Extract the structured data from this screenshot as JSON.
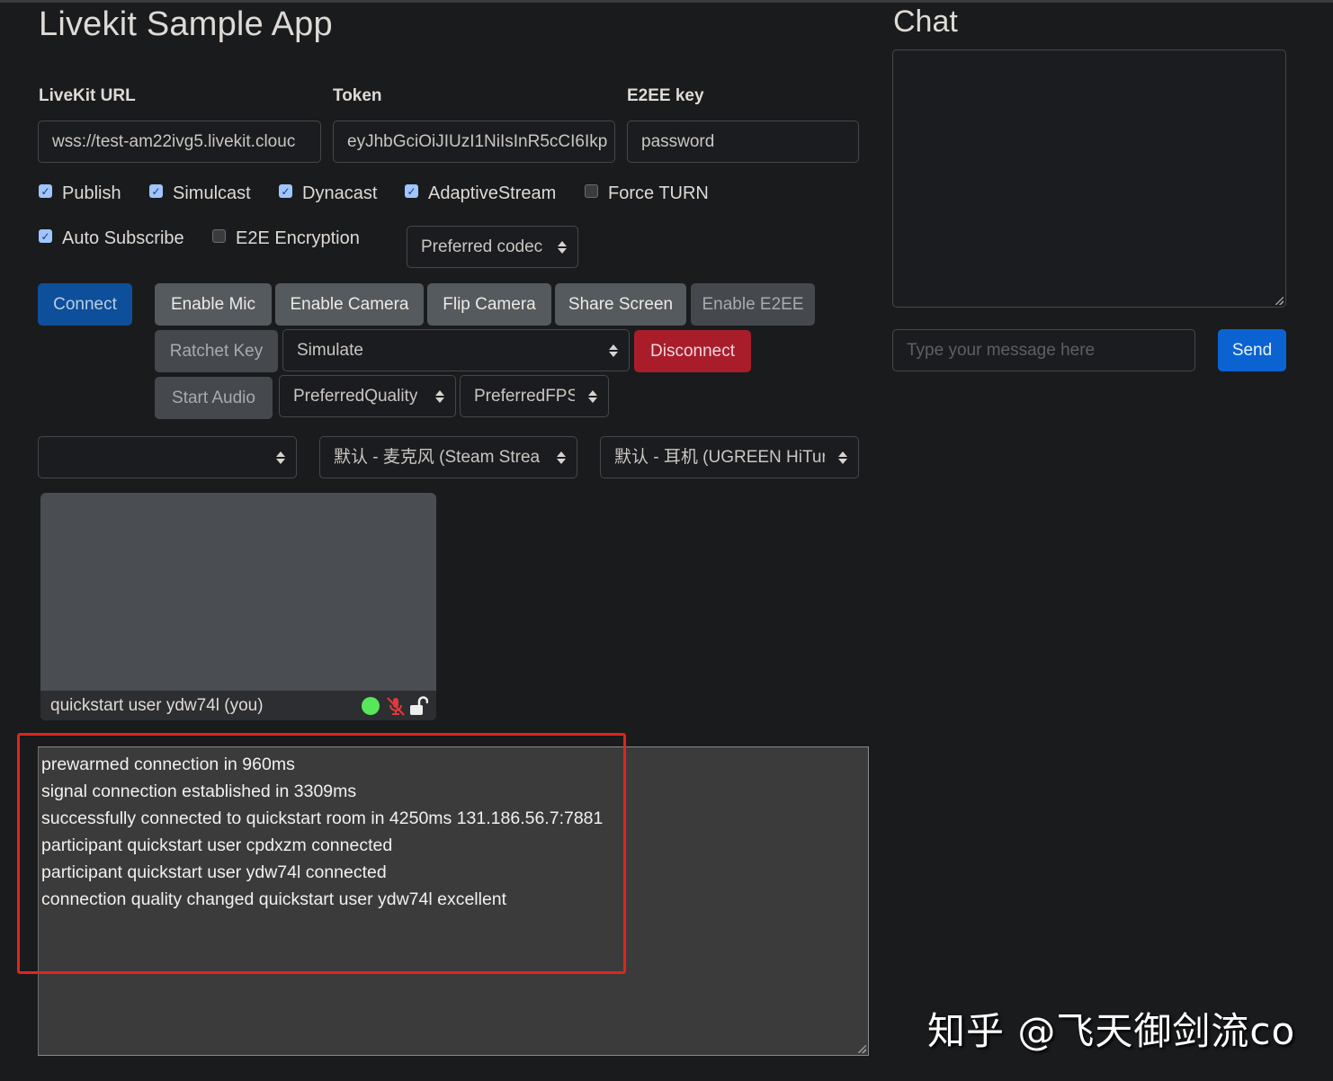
{
  "app": {
    "title": "Livekit Sample App"
  },
  "form": {
    "url_label": "LiveKit URL",
    "url_value": "wss://test-am22ivg5.livekit.clouc",
    "token_label": "Token",
    "token_value": "eyJhbGciOiJIUzI1NiIsInR5cCI6Ikp",
    "e2ee_label": "E2EE key",
    "e2ee_value": "password"
  },
  "options": [
    {
      "label": "Publish",
      "checked": true
    },
    {
      "label": "Simulcast",
      "checked": true
    },
    {
      "label": "Dynacast",
      "checked": true
    },
    {
      "label": "AdaptiveStream",
      "checked": true
    },
    {
      "label": "Force TURN",
      "checked": false
    },
    {
      "label": "Auto Subscribe",
      "checked": true
    },
    {
      "label": "E2E Encryption",
      "checked": false
    }
  ],
  "codec_select": {
    "value": "Preferred codec"
  },
  "buttons": {
    "connect": "Connect",
    "enable_mic": "Enable Mic",
    "enable_camera": "Enable Camera",
    "flip_camera": "Flip Camera",
    "share_screen": "Share Screen",
    "enable_e2ee": "Enable E2EE",
    "ratchet_key": "Ratchet Key",
    "disconnect": "Disconnect",
    "start_audio": "Start Audio"
  },
  "simulate_select": {
    "value": "Simulate"
  },
  "quality_select": {
    "value": "PreferredQuality"
  },
  "fps_select": {
    "value": "PreferredFPS"
  },
  "devices": {
    "video": "",
    "audio_input": "默认 - 麦克风 (Steam Strea",
    "audio_output": "默认 - 耳机 (UGREEN HiTur"
  },
  "participant": {
    "name": "quickstart user ydw74l (you)",
    "connection_quality": "excellent",
    "mic_muted": true,
    "encrypted": false
  },
  "log": [
    "prewarmed connection in 960ms",
    "signal connection established in 3309ms",
    "successfully connected to quickstart room in 4250ms 131.186.56.7:7881",
    "participant quickstart user cpdxzm connected",
    "participant quickstart user ydw74l connected",
    "connection quality changed quickstart user ydw74l excellent"
  ],
  "chat": {
    "title": "Chat",
    "messages": "",
    "input_placeholder": "Type your message here",
    "send_label": "Send"
  },
  "watermark": "知乎 @飞天御剑流co",
  "colors": {
    "primary": "#0d4f9a",
    "send": "#0a63d1",
    "danger": "#a91d2b",
    "status_good": "#58e65a",
    "muted": "#e0383b",
    "highlight": "#e0241f"
  }
}
